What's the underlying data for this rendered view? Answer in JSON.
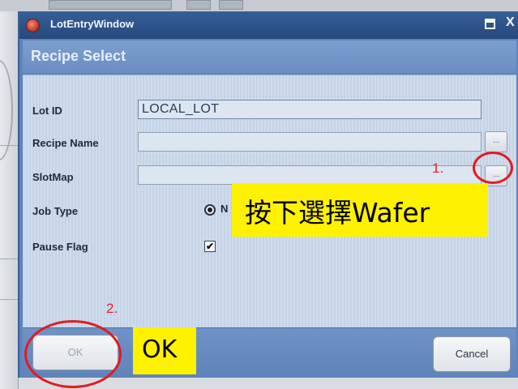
{
  "window": {
    "title": "LotEntryWindow",
    "close_glyph": "X",
    "header": "Recipe Select"
  },
  "form": {
    "lot_id": {
      "label": "Lot ID",
      "value": "LOCAL_LOT"
    },
    "recipe_name": {
      "label": "Recipe Name",
      "value": "",
      "browse": "..."
    },
    "slot_map": {
      "label": "SlotMap",
      "value": "",
      "browse": "..."
    },
    "job_type": {
      "label": "Job Type",
      "option_visible": "N"
    },
    "pause_flag": {
      "label": "Pause Flag",
      "checked": true,
      "check_glyph": "✔"
    }
  },
  "buttons": {
    "ok": "OK",
    "cancel": "Cancel"
  },
  "annotations": {
    "step1": "1.",
    "step2": "2.",
    "callout": "按下選擇Wafer",
    "ok_note": "OK",
    "highlight_color": "#fff200",
    "marker_color": "#e11b24"
  }
}
